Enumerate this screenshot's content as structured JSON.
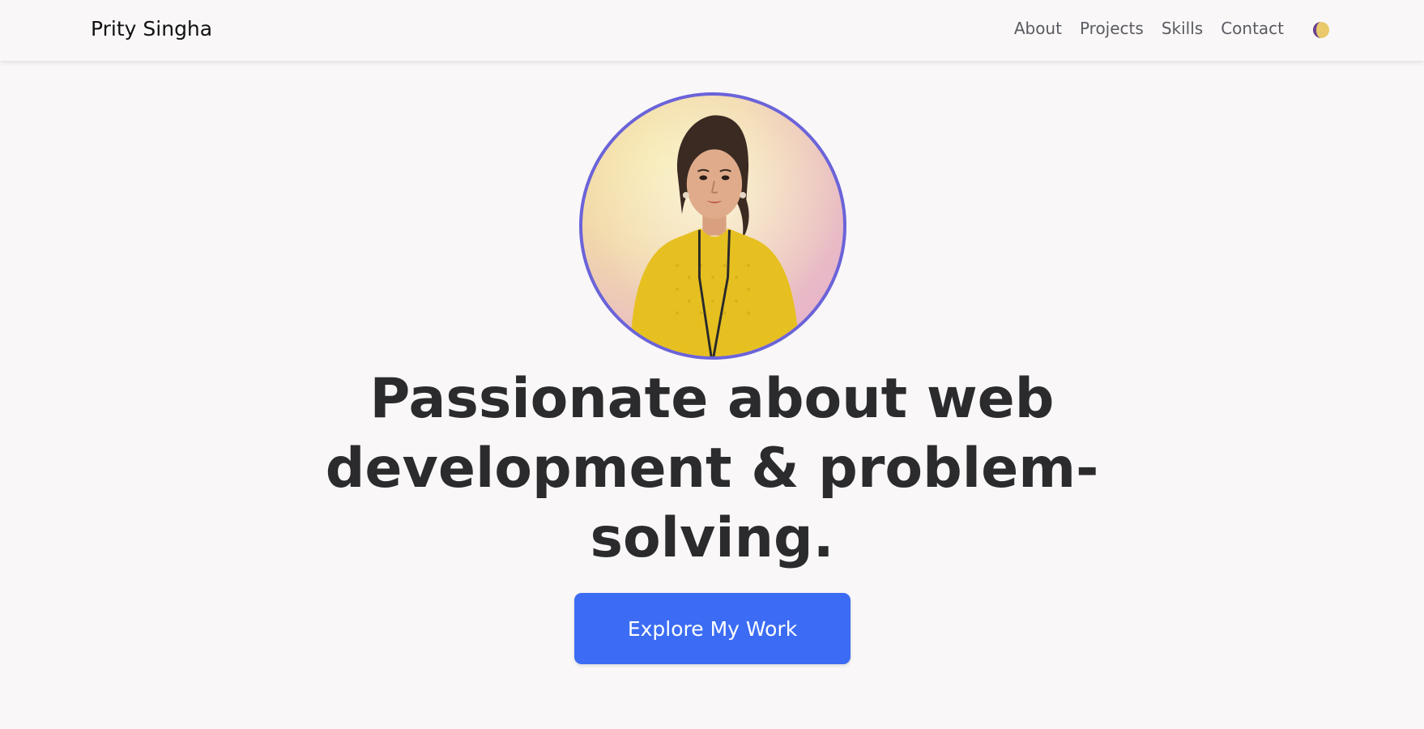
{
  "header": {
    "brand": "Prity Singha",
    "nav": {
      "about": "About",
      "projects": "Projects",
      "skills": "Skills",
      "contact": "Contact"
    },
    "theme_toggle_icon": "half-moon-theme-icon"
  },
  "hero": {
    "headline": "Passionate about web development & problem-solving.",
    "cta_label": "Explore My Work",
    "avatar_icon": "profile-photo"
  },
  "colors": {
    "accent": "#3b6cf3",
    "avatar_border": "#6b63d9",
    "background": "#f9f7f8",
    "text": "#2b2b2d"
  }
}
